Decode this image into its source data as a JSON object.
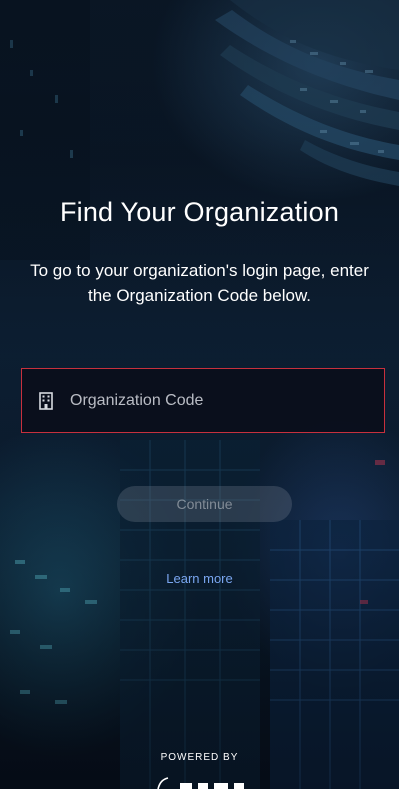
{
  "header": {
    "title": "Find Your Organization",
    "subtitle": "To go to your organization's login page, enter the Organization Code below."
  },
  "org_field": {
    "placeholder": "Organization Code",
    "value": "",
    "icon": "building-icon"
  },
  "actions": {
    "continue_label": "Continue",
    "learn_more_label": "Learn more"
  },
  "footer": {
    "powered_by": "POWERED BY",
    "brand_logo": "brand-logo"
  },
  "colors": {
    "field_border": "#c7303d",
    "link": "#7aa6f0",
    "text": "#ffffff"
  }
}
